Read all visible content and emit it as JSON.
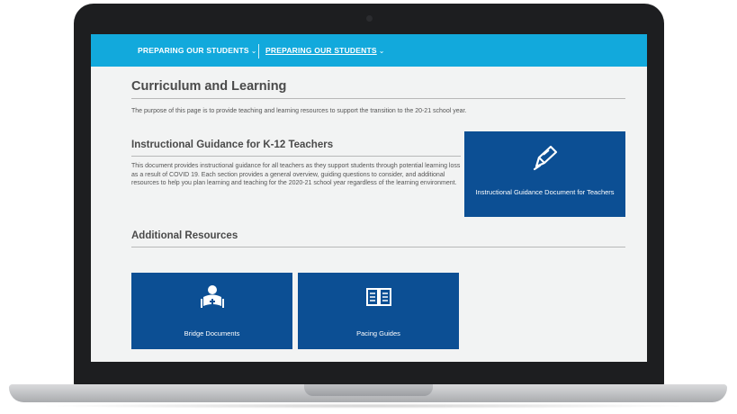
{
  "nav": {
    "item1": "PREPARING OUR STUDENTS",
    "item2": "PREPARING OUR STUDENTS",
    "chevron": "⌄"
  },
  "page": {
    "title": "Curriculum and Learning",
    "intro": "The purpose of this page is to provide teaching and learning resources to support the transition to the 20-21 school year."
  },
  "guidance": {
    "heading": "Instructional Guidance for K-12 Teachers",
    "body": "This document provides instructional guidance for all teachers as they support students through potential learning loss as a result of COVID 19. Each section provides a general overview, guiding questions to consider, and additional resources to help you plan learning and teaching for the 2020-21 school year regardless of the learning environment.",
    "card_label": "Instructional Guidance Document for Teachers",
    "card_icon": "pen-icon"
  },
  "resources": {
    "heading": "Additional Resources",
    "cards": [
      {
        "label": "Bridge Documents",
        "icon": "student-reading-icon"
      },
      {
        "label": "Pacing Guides",
        "icon": "open-book-icon"
      }
    ]
  },
  "colors": {
    "nav": "#12a9dc",
    "card": "#0c4f94",
    "background": "#f2f3f3"
  }
}
